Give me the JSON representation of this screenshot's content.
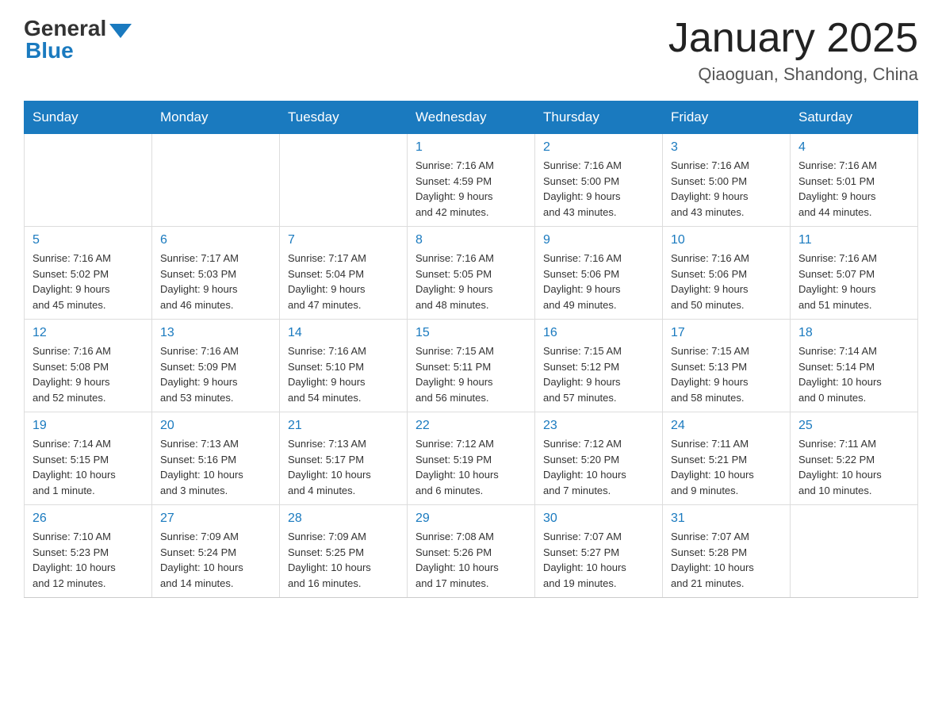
{
  "header": {
    "logo_general": "General",
    "logo_blue": "Blue",
    "month_title": "January 2025",
    "location": "Qiaoguan, Shandong, China"
  },
  "weekdays": [
    "Sunday",
    "Monday",
    "Tuesday",
    "Wednesday",
    "Thursday",
    "Friday",
    "Saturday"
  ],
  "weeks": [
    [
      {
        "day": "",
        "info": ""
      },
      {
        "day": "",
        "info": ""
      },
      {
        "day": "",
        "info": ""
      },
      {
        "day": "1",
        "info": "Sunrise: 7:16 AM\nSunset: 4:59 PM\nDaylight: 9 hours\nand 42 minutes."
      },
      {
        "day": "2",
        "info": "Sunrise: 7:16 AM\nSunset: 5:00 PM\nDaylight: 9 hours\nand 43 minutes."
      },
      {
        "day": "3",
        "info": "Sunrise: 7:16 AM\nSunset: 5:00 PM\nDaylight: 9 hours\nand 43 minutes."
      },
      {
        "day": "4",
        "info": "Sunrise: 7:16 AM\nSunset: 5:01 PM\nDaylight: 9 hours\nand 44 minutes."
      }
    ],
    [
      {
        "day": "5",
        "info": "Sunrise: 7:16 AM\nSunset: 5:02 PM\nDaylight: 9 hours\nand 45 minutes."
      },
      {
        "day": "6",
        "info": "Sunrise: 7:17 AM\nSunset: 5:03 PM\nDaylight: 9 hours\nand 46 minutes."
      },
      {
        "day": "7",
        "info": "Sunrise: 7:17 AM\nSunset: 5:04 PM\nDaylight: 9 hours\nand 47 minutes."
      },
      {
        "day": "8",
        "info": "Sunrise: 7:16 AM\nSunset: 5:05 PM\nDaylight: 9 hours\nand 48 minutes."
      },
      {
        "day": "9",
        "info": "Sunrise: 7:16 AM\nSunset: 5:06 PM\nDaylight: 9 hours\nand 49 minutes."
      },
      {
        "day": "10",
        "info": "Sunrise: 7:16 AM\nSunset: 5:06 PM\nDaylight: 9 hours\nand 50 minutes."
      },
      {
        "day": "11",
        "info": "Sunrise: 7:16 AM\nSunset: 5:07 PM\nDaylight: 9 hours\nand 51 minutes."
      }
    ],
    [
      {
        "day": "12",
        "info": "Sunrise: 7:16 AM\nSunset: 5:08 PM\nDaylight: 9 hours\nand 52 minutes."
      },
      {
        "day": "13",
        "info": "Sunrise: 7:16 AM\nSunset: 5:09 PM\nDaylight: 9 hours\nand 53 minutes."
      },
      {
        "day": "14",
        "info": "Sunrise: 7:16 AM\nSunset: 5:10 PM\nDaylight: 9 hours\nand 54 minutes."
      },
      {
        "day": "15",
        "info": "Sunrise: 7:15 AM\nSunset: 5:11 PM\nDaylight: 9 hours\nand 56 minutes."
      },
      {
        "day": "16",
        "info": "Sunrise: 7:15 AM\nSunset: 5:12 PM\nDaylight: 9 hours\nand 57 minutes."
      },
      {
        "day": "17",
        "info": "Sunrise: 7:15 AM\nSunset: 5:13 PM\nDaylight: 9 hours\nand 58 minutes."
      },
      {
        "day": "18",
        "info": "Sunrise: 7:14 AM\nSunset: 5:14 PM\nDaylight: 10 hours\nand 0 minutes."
      }
    ],
    [
      {
        "day": "19",
        "info": "Sunrise: 7:14 AM\nSunset: 5:15 PM\nDaylight: 10 hours\nand 1 minute."
      },
      {
        "day": "20",
        "info": "Sunrise: 7:13 AM\nSunset: 5:16 PM\nDaylight: 10 hours\nand 3 minutes."
      },
      {
        "day": "21",
        "info": "Sunrise: 7:13 AM\nSunset: 5:17 PM\nDaylight: 10 hours\nand 4 minutes."
      },
      {
        "day": "22",
        "info": "Sunrise: 7:12 AM\nSunset: 5:19 PM\nDaylight: 10 hours\nand 6 minutes."
      },
      {
        "day": "23",
        "info": "Sunrise: 7:12 AM\nSunset: 5:20 PM\nDaylight: 10 hours\nand 7 minutes."
      },
      {
        "day": "24",
        "info": "Sunrise: 7:11 AM\nSunset: 5:21 PM\nDaylight: 10 hours\nand 9 minutes."
      },
      {
        "day": "25",
        "info": "Sunrise: 7:11 AM\nSunset: 5:22 PM\nDaylight: 10 hours\nand 10 minutes."
      }
    ],
    [
      {
        "day": "26",
        "info": "Sunrise: 7:10 AM\nSunset: 5:23 PM\nDaylight: 10 hours\nand 12 minutes."
      },
      {
        "day": "27",
        "info": "Sunrise: 7:09 AM\nSunset: 5:24 PM\nDaylight: 10 hours\nand 14 minutes."
      },
      {
        "day": "28",
        "info": "Sunrise: 7:09 AM\nSunset: 5:25 PM\nDaylight: 10 hours\nand 16 minutes."
      },
      {
        "day": "29",
        "info": "Sunrise: 7:08 AM\nSunset: 5:26 PM\nDaylight: 10 hours\nand 17 minutes."
      },
      {
        "day": "30",
        "info": "Sunrise: 7:07 AM\nSunset: 5:27 PM\nDaylight: 10 hours\nand 19 minutes."
      },
      {
        "day": "31",
        "info": "Sunrise: 7:07 AM\nSunset: 5:28 PM\nDaylight: 10 hours\nand 21 minutes."
      },
      {
        "day": "",
        "info": ""
      }
    ]
  ]
}
